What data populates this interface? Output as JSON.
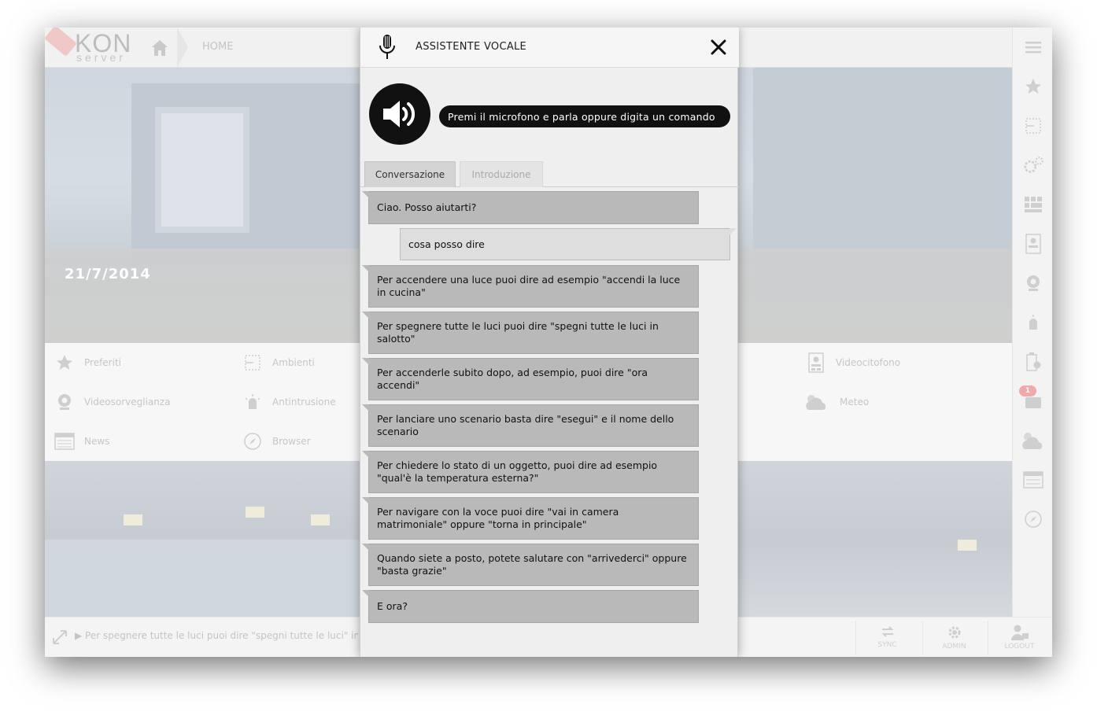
{
  "app": {
    "logo_main": "KON",
    "logo_sub": "server",
    "breadcrumb_home": "HOME",
    "date": "21/7/2014",
    "menu": [
      {
        "label": "Preferiti",
        "icon": "star-icon"
      },
      {
        "label": "Ambienti",
        "icon": "floorplan-icon"
      },
      {
        "label": "Videocitofono",
        "icon": "intercom-icon"
      },
      {
        "label": "Videosorveglianza",
        "icon": "camera-icon"
      },
      {
        "label": "Antintrusione",
        "icon": "alarm-icon"
      },
      {
        "label": "Meteo",
        "icon": "weather-icon"
      },
      {
        "label": "News",
        "icon": "news-icon"
      },
      {
        "label": "Browser",
        "icon": "compass-icon"
      }
    ],
    "footer_text": "▶ Per spegnere tutte le luci puoi dire \"spegni tutte le luci\" in salotto",
    "footer_buttons": [
      "SYNC",
      "ADMIN",
      "LOGOUT"
    ],
    "notification_count": "1",
    "colors": {
      "accent": "#111111",
      "bot_bubble": "#b9b9b9",
      "user_bubble": "#dedede",
      "badge": "#f0a8a8"
    }
  },
  "assistant": {
    "title": "ASSISTENTE VOCALE",
    "prompt": "Premi il microfono e parla oppure digita un comando",
    "tabs": [
      "Conversazione",
      "Introduzione"
    ],
    "active_tab": "Conversazione",
    "messages": [
      {
        "from": "bot",
        "text": "Ciao. Posso aiutarti?"
      },
      {
        "from": "user",
        "text": "cosa posso dire"
      },
      {
        "from": "bot",
        "text": "Per accendere una luce puoi dire ad esempio \"accendi la luce in cucina\""
      },
      {
        "from": "bot",
        "text": "Per spegnere tutte le luci puoi dire \"spegni tutte le luci in salotto\""
      },
      {
        "from": "bot",
        "text": "Per accenderle subito dopo, ad esempio, puoi dire \"ora accendi\""
      },
      {
        "from": "bot",
        "text": "Per lanciare uno scenario basta dire \"esegui\" e il nome dello scenario"
      },
      {
        "from": "bot",
        "text": "Per chiedere lo stato di un oggetto, puoi dire ad esempio \"qual'è la temperatura esterna?\""
      },
      {
        "from": "bot",
        "text": "Per navigare con la voce puoi dire \"vai in camera matrimoniale\" oppure \"torna in principale\""
      },
      {
        "from": "bot",
        "text": "Quando siete a posto, potete salutare con \"arrivederci\" oppure \"basta grazie\""
      },
      {
        "from": "bot",
        "text": "E ora?"
      }
    ]
  }
}
